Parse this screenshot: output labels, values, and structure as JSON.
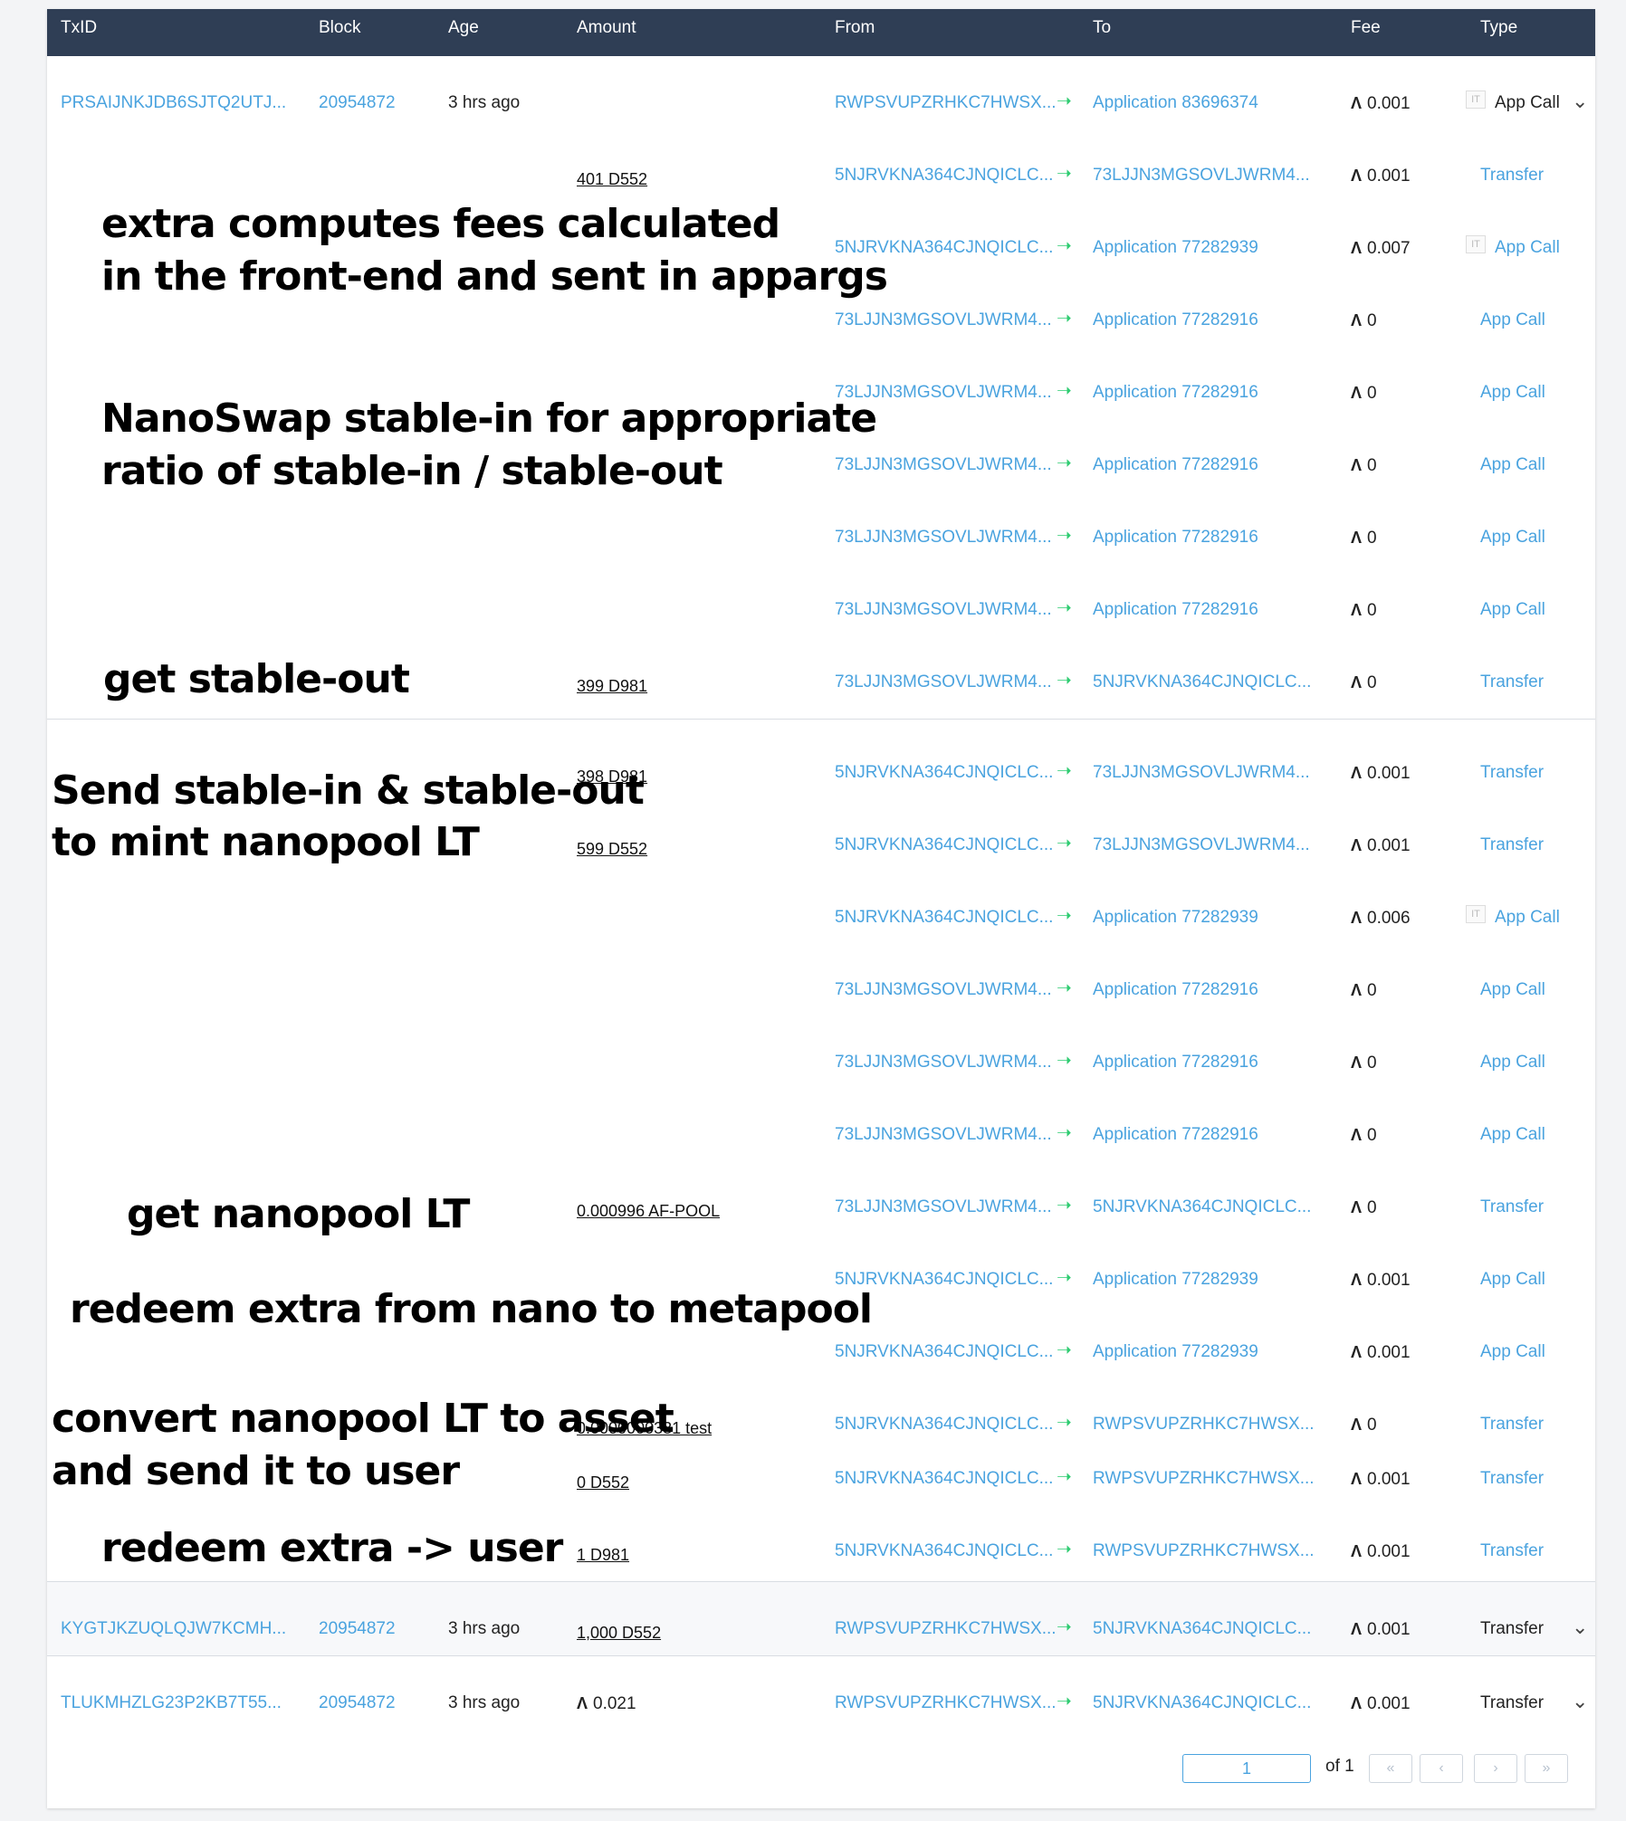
{
  "header": {
    "txid": "TxID",
    "block": "Block",
    "age": "Age",
    "amount": "Amount",
    "from": "From",
    "to": "To",
    "fee": "Fee",
    "type": "Type"
  },
  "rows": [
    {
      "txid": "PRSAIJNKJDB6SJTQ2UTJ...",
      "block": "20954872",
      "age": "3 hrs ago",
      "amount": "",
      "from": "RWPSVUPZRHKC7HWSX...",
      "to": "Application 83696374",
      "fee": "0.001",
      "type": "App Call",
      "it_icon": true,
      "type_dark": true,
      "chevron": true
    },
    {
      "txid": "",
      "block": "",
      "age": "",
      "amount": "401 D552",
      "from": "5NJRVKNA364CJNQICLC...",
      "to": "73LJJN3MGSOVLJWRM4...",
      "fee": "0.001",
      "type": "Transfer"
    },
    {
      "txid": "",
      "block": "",
      "age": "",
      "amount": "",
      "from": "5NJRVKNA364CJNQICLC...",
      "to": "Application 77282939",
      "fee": "0.007",
      "type": "App Call",
      "it_icon": true
    },
    {
      "txid": "",
      "block": "",
      "age": "",
      "amount": "",
      "from": "73LJJN3MGSOVLJWRM4...",
      "to": "Application 77282916",
      "fee": "0",
      "type": "App Call"
    },
    {
      "txid": "",
      "block": "",
      "age": "",
      "amount": "",
      "from": "73LJJN3MGSOVLJWRM4...",
      "to": "Application 77282916",
      "fee": "0",
      "type": "App Call"
    },
    {
      "txid": "",
      "block": "",
      "age": "",
      "amount": "",
      "from": "73LJJN3MGSOVLJWRM4...",
      "to": "Application 77282916",
      "fee": "0",
      "type": "App Call"
    },
    {
      "txid": "",
      "block": "",
      "age": "",
      "amount": "",
      "from": "73LJJN3MGSOVLJWRM4...",
      "to": "Application 77282916",
      "fee": "0",
      "type": "App Call"
    },
    {
      "txid": "",
      "block": "",
      "age": "",
      "amount": "",
      "from": "73LJJN3MGSOVLJWRM4...",
      "to": "Application 77282916",
      "fee": "0",
      "type": "App Call"
    },
    {
      "txid": "",
      "block": "",
      "age": "",
      "amount": "399 D981",
      "from": "73LJJN3MGSOVLJWRM4...",
      "to": "5NJRVKNA364CJNQICLC...",
      "fee": "0",
      "type": "Transfer"
    },
    {
      "txid": "",
      "block": "",
      "age": "",
      "amount": "398 D981",
      "from": "5NJRVKNA364CJNQICLC...",
      "to": "73LJJN3MGSOVLJWRM4...",
      "fee": "0.001",
      "type": "Transfer"
    },
    {
      "txid": "",
      "block": "",
      "age": "",
      "amount": "599 D552",
      "from": "5NJRVKNA364CJNQICLC...",
      "to": "73LJJN3MGSOVLJWRM4...",
      "fee": "0.001",
      "type": "Transfer"
    },
    {
      "txid": "",
      "block": "",
      "age": "",
      "amount": "",
      "from": "5NJRVKNA364CJNQICLC...",
      "to": "Application 77282939",
      "fee": "0.006",
      "type": "App Call",
      "it_icon": true
    },
    {
      "txid": "",
      "block": "",
      "age": "",
      "amount": "",
      "from": "73LJJN3MGSOVLJWRM4...",
      "to": "Application 77282916",
      "fee": "0",
      "type": "App Call"
    },
    {
      "txid": "",
      "block": "",
      "age": "",
      "amount": "",
      "from": "73LJJN3MGSOVLJWRM4...",
      "to": "Application 77282916",
      "fee": "0",
      "type": "App Call"
    },
    {
      "txid": "",
      "block": "",
      "age": "",
      "amount": "",
      "from": "73LJJN3MGSOVLJWRM4...",
      "to": "Application 77282916",
      "fee": "0",
      "type": "App Call"
    },
    {
      "txid": "",
      "block": "",
      "age": "",
      "amount": "0.000996 AF-POOL",
      "from": "73LJJN3MGSOVLJWRM4...",
      "to": "5NJRVKNA364CJNQICLC...",
      "fee": "0",
      "type": "Transfer"
    },
    {
      "txid": "",
      "block": "",
      "age": "",
      "amount": "",
      "from": "5NJRVKNA364CJNQICLC...",
      "to": "Application 77282939",
      "fee": "0.001",
      "type": "App Call"
    },
    {
      "txid": "",
      "block": "",
      "age": "",
      "amount": "",
      "from": "5NJRVKNA364CJNQICLC...",
      "to": "Application 77282939",
      "fee": "0.001",
      "type": "App Call"
    },
    {
      "txid": "",
      "block": "",
      "age": "",
      "amount": "0.0000000331 test",
      "from": "5NJRVKNA364CJNQICLC...",
      "to": "RWPSVUPZRHKC7HWSX...",
      "fee": "0",
      "type": "Transfer"
    },
    {
      "txid": "",
      "block": "",
      "age": "",
      "amount": "0 D552",
      "from": "5NJRVKNA364CJNQICLC...",
      "to": "RWPSVUPZRHKC7HWSX...",
      "fee": "0.001",
      "type": "Transfer"
    },
    {
      "txid": "",
      "block": "",
      "age": "",
      "amount": "1 D981",
      "from": "5NJRVKNA364CJNQICLC...",
      "to": "RWPSVUPZRHKC7HWSX...",
      "fee": "0.001",
      "type": "Transfer"
    },
    {
      "txid": "KYGTJKZUQLQJW7KCMH...",
      "block": "20954872",
      "age": "3 hrs ago",
      "amount": "1,000 D552",
      "from": "RWPSVUPZRHKC7HWSX...",
      "to": "5NJRVKNA364CJNQICLC...",
      "fee": "0.001",
      "type": "Transfer",
      "type_dark": true,
      "chevron": true
    },
    {
      "txid": "TLUKMHZLG23P2KB7T55...",
      "block": "20954872",
      "age": "3 hrs ago",
      "amount": "0.021",
      "amount_algo": true,
      "from": "RWPSVUPZRHKC7HWSX...",
      "to": "5NJRVKNA364CJNQICLC...",
      "fee": "0.001",
      "type": "Transfer",
      "type_dark": true,
      "chevron": true
    }
  ],
  "annotations": [
    {
      "text": "extra computes fees calculated"
    },
    {
      "text": "in the front-end and sent in appargs"
    },
    {
      "text": "NanoSwap stable-in for appropriate"
    },
    {
      "text": "ratio of stable-in / stable-out"
    },
    {
      "text": "get stable-out"
    },
    {
      "text": "Send stable-in & stable-out"
    },
    {
      "text": "to mint nanopool LT"
    },
    {
      "text": "get nanopool LT"
    },
    {
      "text": "redeem extra from nano to metapool"
    },
    {
      "text": "convert nanopool LT to asset"
    },
    {
      "text": "and send it to user"
    },
    {
      "text": "redeem extra -> user"
    }
  ],
  "pagination": {
    "current_page": "1",
    "of_label": "of 1"
  },
  "icons": {
    "algo": "algorand-icon",
    "arrow": "right-arrow-icon",
    "chevron": "chevron-down-icon",
    "it": "inner-txn-icon"
  },
  "colors": {
    "header_bg": "#2f3e55",
    "link": "#4aa3df",
    "arrow": "#2ecc71"
  }
}
